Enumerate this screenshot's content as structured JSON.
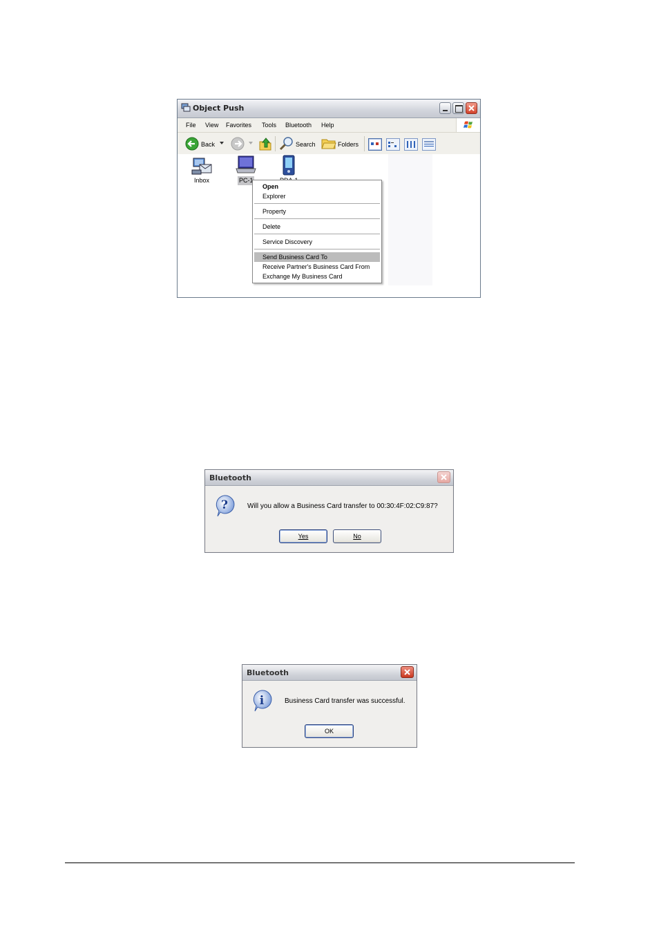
{
  "explorer": {
    "title": "Object Push",
    "menu": [
      "File",
      "View",
      "Favorites",
      "Tools",
      "Bluetooth",
      "Help"
    ],
    "toolbar": {
      "back": "Back",
      "search": "Search",
      "folders": "Folders"
    },
    "items": [
      {
        "label": "Inbox"
      },
      {
        "label": "PC-1"
      },
      {
        "label": "PDA-1"
      }
    ],
    "context_menu": [
      "Open",
      "Explorer",
      "Property",
      "Delete",
      "Service Discovery",
      "Send Business Card To",
      "Receive Partner's Business Card From",
      "Exchange My Business Card"
    ],
    "highlighted_menu_item": "Send Business Card To"
  },
  "dialog_confirm": {
    "title": "Bluetooth",
    "message": "Will you allow a Business Card transfer to",
    "address": "00:30:4F:02:C9:87?",
    "yes_label": "Yes",
    "no_label": "No"
  },
  "dialog_success": {
    "title": "Bluetooth",
    "message": "Business Card transfer was successful.",
    "ok_label": "OK"
  }
}
